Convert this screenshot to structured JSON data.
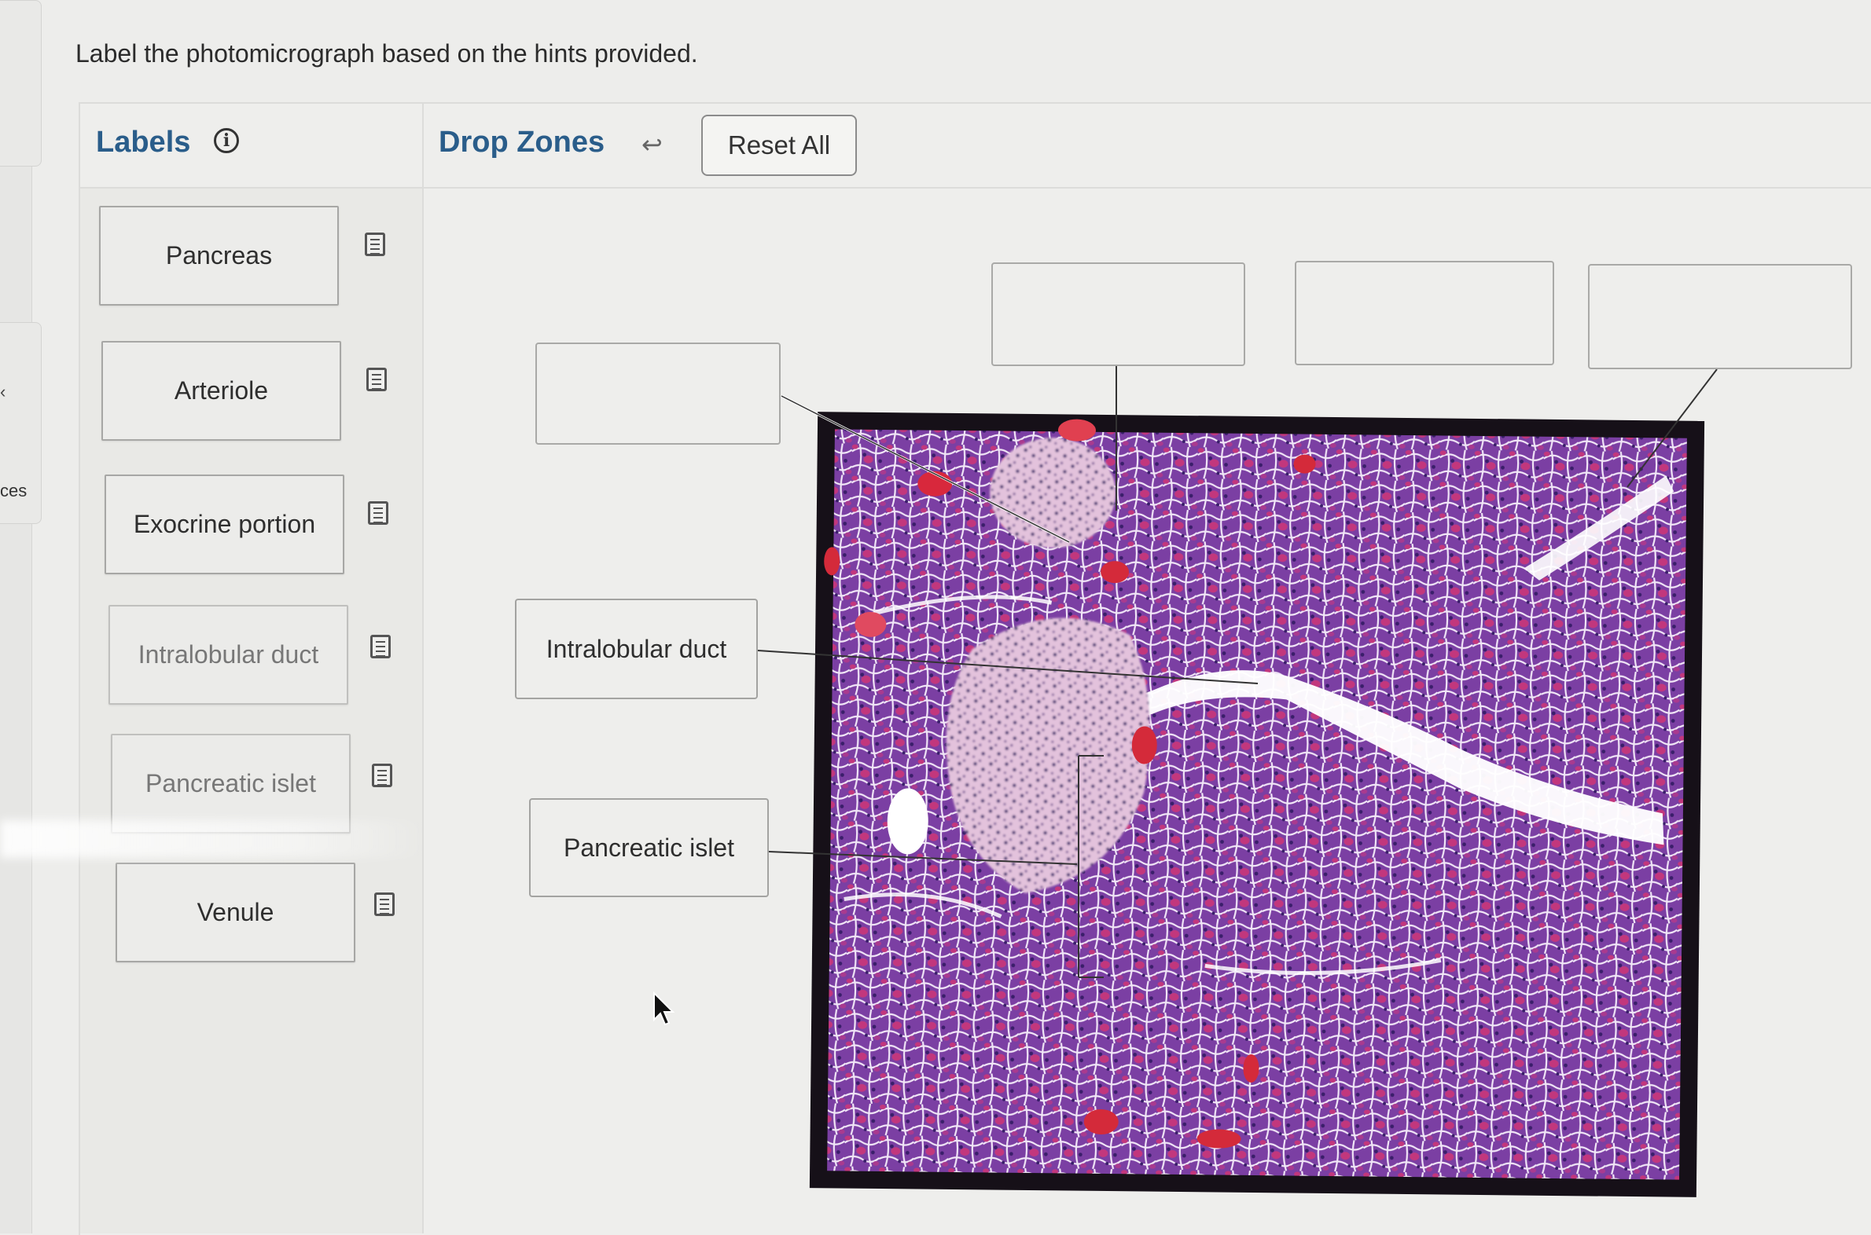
{
  "instruction": "Label the photomicrograph based on the hints provided.",
  "edge": {
    "fragment_text": "ces",
    "chevron": "‹"
  },
  "labels_panel": {
    "title": "Labels",
    "info_icon": "info-icon",
    "items": [
      {
        "label": "Pancreas",
        "state": "available",
        "hint_icon": "hint-document-icon"
      },
      {
        "label": "Arteriole",
        "state": "available",
        "hint_icon": "hint-document-icon"
      },
      {
        "label": "Exocrine portion",
        "state": "available",
        "hint_icon": "hint-document-icon"
      },
      {
        "label": "Intralobular duct",
        "state": "used",
        "hint_icon": "hint-document-icon"
      },
      {
        "label": "Pancreatic islet",
        "state": "used",
        "hint_icon": "hint-document-icon"
      },
      {
        "label": "Venule",
        "state": "available",
        "hint_icon": "hint-document-icon"
      }
    ]
  },
  "drop_zones_panel": {
    "title": "Drop Zones",
    "undo_icon": "undo-arrow-icon",
    "reset_label": "Reset All",
    "placed_labels": [
      {
        "label": "Intralobular duct"
      },
      {
        "label": "Pancreatic islet"
      }
    ],
    "empty_zone_count": 4
  },
  "image": {
    "subject": "pancreas-histology-photomicrograph"
  },
  "colors": {
    "header_blue": "#2a5d8a",
    "background": "#ededeb",
    "card_border": "#a7a7a5",
    "tissue_purple": "#7a3a9e",
    "tissue_pink": "#c13a7a",
    "islet_pink": "#e0b9d6",
    "rbc_red": "#d42a3a"
  }
}
